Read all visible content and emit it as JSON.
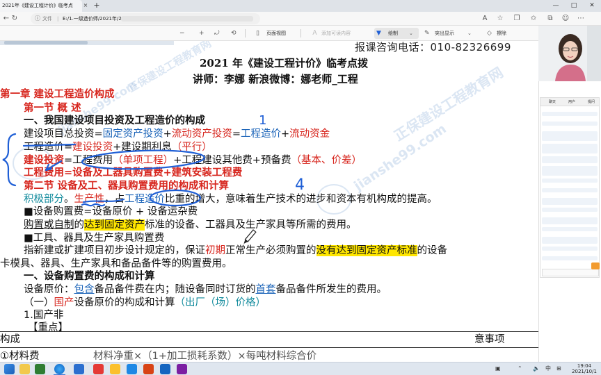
{
  "browser": {
    "tab_title": "2021年《建设工程计价》临考点",
    "tab_close": "×",
    "new_tab": "+",
    "minimize": "—",
    "maximize": "□",
    "close": "✕",
    "url_label": "文件",
    "url_text": "E:/1.一级造价师/2021年/2021年"
  },
  "pdf_toolbar": {
    "page_view": "页面视图",
    "add_text": "添加可读内容",
    "draw": "绘制",
    "highlight": "突出显示",
    "erase": "擦除"
  },
  "document": {
    "consult": "报课咨询电话：010-82326699",
    "title": "2021 年《建设工程计价》临考点拨",
    "lecturer": "讲师：李娜   新浪微博：娜老师_工程",
    "chapter": "第一章  建设工程造价构成",
    "section1": "第一节   概   述",
    "heading1": "一、我国建设项目投资及工程造价的构成",
    "l_total_a": "建设项目总投资=",
    "l_total_b": "固定资产投资",
    "l_total_c": "+",
    "l_total_d": "流动资产投资",
    "l_total_e": "=",
    "l_total_f": "工程造价",
    "l_total_g": "+",
    "l_total_h": "流动资金",
    "l_cost_a": "工程造价=",
    "l_cost_b": "建设投资",
    "l_cost_c": "+建设期利息",
    "l_cost_d": "（平行）",
    "l_invest_a": "建设投资",
    "l_invest_b": "=工程费用",
    "l_invest_c": "（单项工程）",
    "l_invest_d": "+工程建设其他费+预备费",
    "l_invest_e": "（基本、价差）",
    "l_fee": "工程费用=设备及工器具购置费+建筑安装工程费",
    "section2": "第二节   设备及工、器具购置费用的构成和计算",
    "l_pos_a": "积极部分",
    "l_pos_b": "。",
    "l_pos_c": "生产性",
    "l_pos_d": "，占",
    "l_pos_e": "工程造价",
    "l_pos_f": "比重的增大，意味着生产技术的进步和资本有机构成的提高。",
    "l_equip": "■设备购置费=设备原价 + 设备运杂费",
    "l_buy_a": "购置或自制",
    "l_buy_b": "的",
    "l_buy_c": "达到固定资产",
    "l_buy_d": "标准的设备、工器具及生产家具等所需的费用。",
    "l_tools": "■工具、器具及生产家具购置费",
    "l_def_a": "指新建或扩建项目初步设计规定的，保证",
    "l_def_b": "初期",
    "l_def_c": "正常生产必须购置的",
    "l_def_d": "没有达到固定资产标准",
    "l_def_e": "的设备",
    "l_def2": "卡模具、器具、生产家具和备品备件等的购置费用。",
    "heading2": "一、设备购置费的构成和计算",
    "l_orig_a": "设备原价：",
    "l_orig_b": "包含",
    "l_orig_c": "备品备件费在内；随设备同时订货的",
    "l_orig_d": "首套",
    "l_orig_e": "备品备件所发生的费用。",
    "l_sub1_a": "（一）",
    "l_sub1_b": "国产",
    "l_sub1_c": "设备原价的构成和计算",
    "l_sub1_d": "（出厂（场）价格）",
    "l_domestic": "1.国产非",
    "l_key": "【重点】",
    "table_col1": "构成",
    "table_col2": "意事项",
    "table_row1": "①材料费",
    "table_row1b": "材料净重×（1+加工损耗系数）×每吨材料综合价"
  },
  "annotations": {
    "mark_1": "1",
    "mark_4": "4"
  },
  "watermarks": {
    "site": "jianshe99.com",
    "brand": "正保建设工程教育网"
  },
  "chat": {
    "tab1": "聊天",
    "tab2": "用户",
    "tab3": "提问"
  },
  "taskbar": {
    "ime": "中",
    "time": "19:04",
    "date": "2021/10/1"
  },
  "colors": {
    "red": "#d7261e",
    "blue": "#1a63b8",
    "teal": "#108a9c",
    "highlight": "#ffe600",
    "pen_blue": "#1f5fd6"
  }
}
